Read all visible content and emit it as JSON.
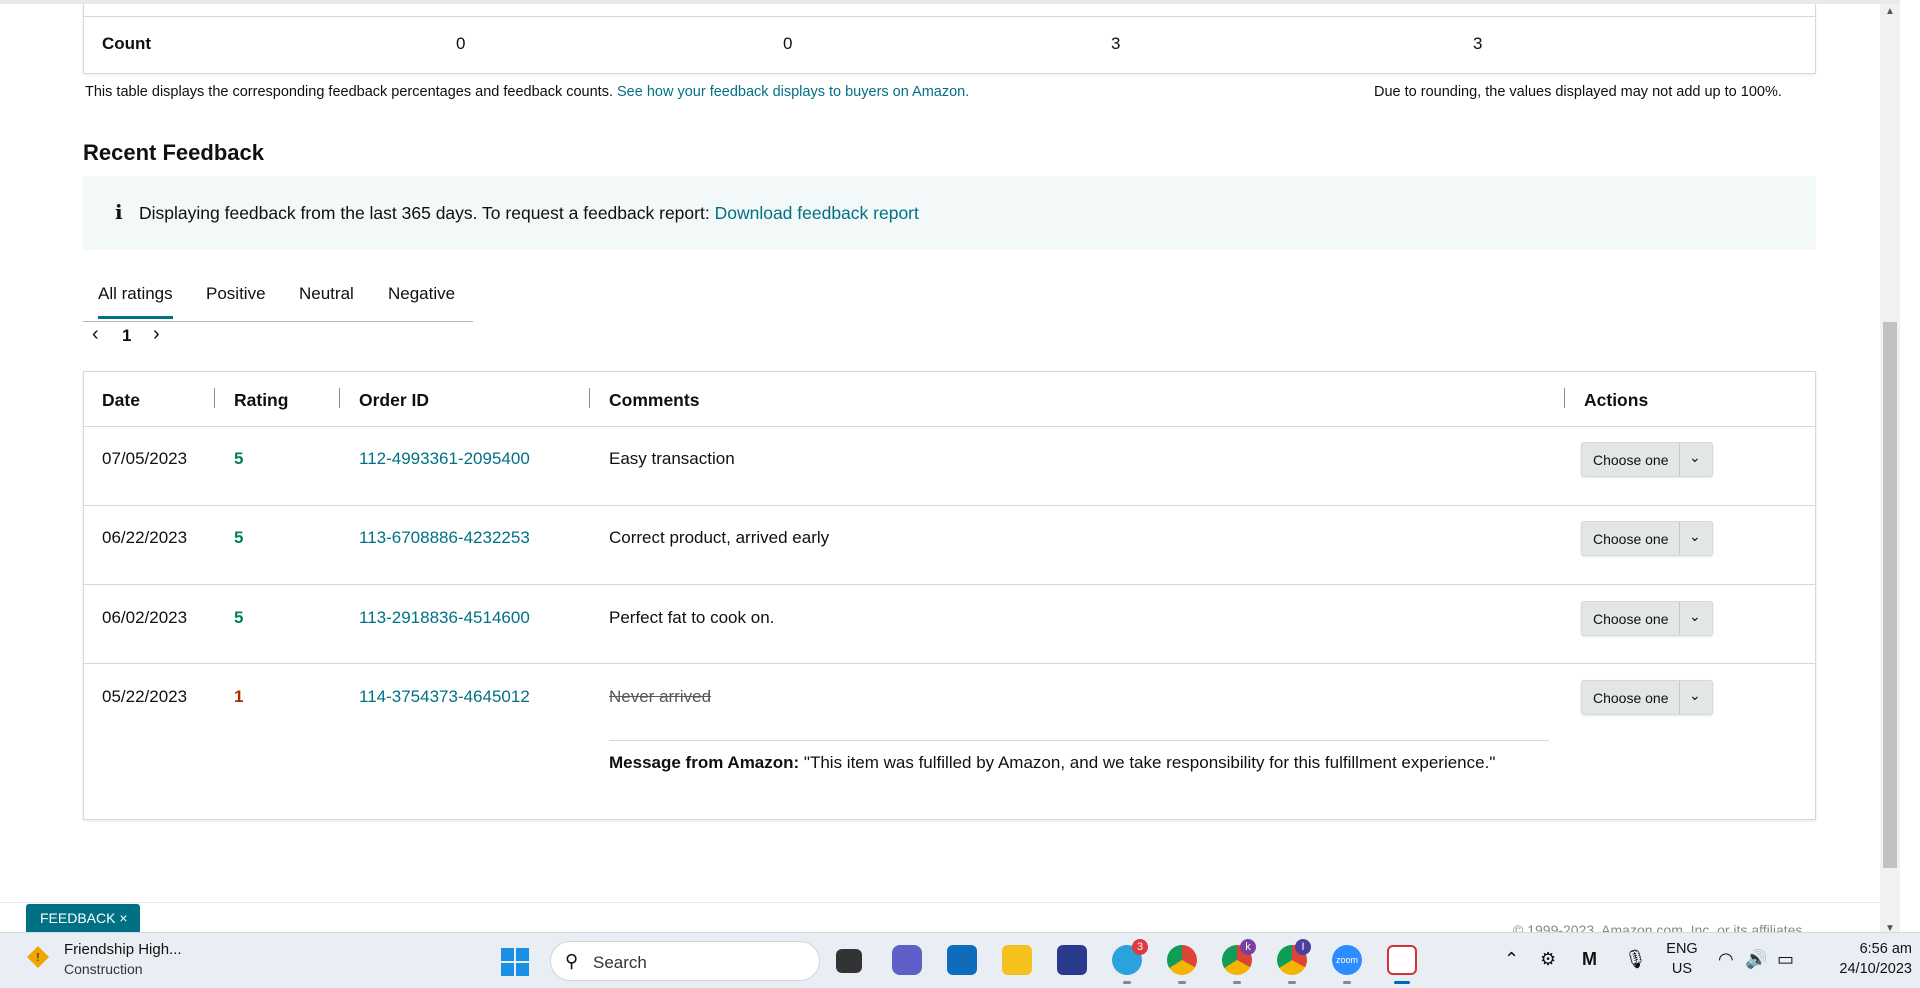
{
  "count_row": {
    "label": "Count",
    "values": [
      "0",
      "0",
      "3",
      "3"
    ]
  },
  "notes": {
    "left_text": "This table displays the corresponding feedback percentages and feedback counts.",
    "left_link": "See how your feedback displays to buyers on Amazon.",
    "right_text": "Due to rounding, the values displayed may not add up to 100%."
  },
  "recent_feedback": {
    "title": "Recent Feedback",
    "info_text": "Displaying feedback from the last 365 days. To request a feedback report:",
    "info_link": "Download feedback report",
    "tabs": [
      "All ratings",
      "Positive",
      "Neutral",
      "Negative"
    ],
    "active_tab": "All ratings",
    "pager": {
      "prev": "‹",
      "page": "1",
      "next": "›"
    }
  },
  "table": {
    "headers": [
      "Date",
      "Rating",
      "Order ID",
      "Comments",
      "Actions"
    ],
    "rows": [
      {
        "date": "07/05/2023",
        "rating": "5",
        "order_id": "112-4993361-2095400",
        "comment": "Easy transaction",
        "action": "Choose one"
      },
      {
        "date": "06/22/2023",
        "rating": "5",
        "order_id": "113-6708886-4232253",
        "comment": "Correct product, arrived early",
        "action": "Choose one"
      },
      {
        "date": "06/02/2023",
        "rating": "5",
        "order_id": "113-2918836-4514600",
        "comment": "Perfect fat to cook on.",
        "action": "Choose one"
      },
      {
        "date": "05/22/2023",
        "rating": "1",
        "order_id": "114-3754373-4645012",
        "comment": "Never arrived",
        "action": "Choose one",
        "amazon_message_label": "Message from Amazon:",
        "amazon_message": "\"This item was fulfilled by Amazon, and we take responsibility for this fulfillment experience.\""
      }
    ]
  },
  "footer": {
    "feedback_tab": "FEEDBACK",
    "close": "×",
    "copyright_fragment": "© 1999-2023, Amazon.com, Inc. or its affiliates"
  },
  "taskbar": {
    "weather_title": "Friendship High...",
    "weather_sub": "Construction",
    "search_placeholder": "Search",
    "telegram_badge": "3",
    "chrome_badge_k": "k",
    "chrome_badge_i": "I",
    "zoom_label": "zoom",
    "lang_top": "ENG",
    "lang_bottom": "US",
    "time": "6:56 am",
    "date": "24/10/2023"
  },
  "colors": {
    "link": "#007185",
    "positive": "#067d62",
    "negative": "#b12704"
  }
}
